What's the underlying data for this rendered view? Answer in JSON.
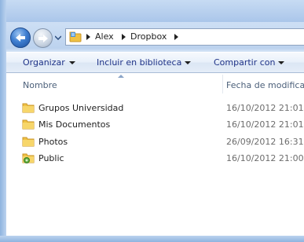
{
  "address_bar": {
    "crumbs": [
      "Alex",
      "Dropbox"
    ]
  },
  "toolbar": {
    "organize": "Organizar",
    "include_library": "Incluir en biblioteca",
    "share_with": "Compartir con"
  },
  "columns": {
    "name": "Nombre",
    "date": "Fecha de modifica"
  },
  "files": [
    {
      "name": "Grupos Universidad",
      "date": "16/10/2012 21:01",
      "icon": "folder-icon"
    },
    {
      "name": "Mis Documentos",
      "date": "16/10/2012 21:01",
      "icon": "folder-icon"
    },
    {
      "name": "Photos",
      "date": "26/09/2012 16:31",
      "icon": "folder-icon"
    },
    {
      "name": "Public",
      "date": "16/10/2012 21:00",
      "icon": "shared-folder-icon"
    }
  ],
  "colors": {
    "folder": "#f0c244",
    "link": "#1e3287"
  }
}
